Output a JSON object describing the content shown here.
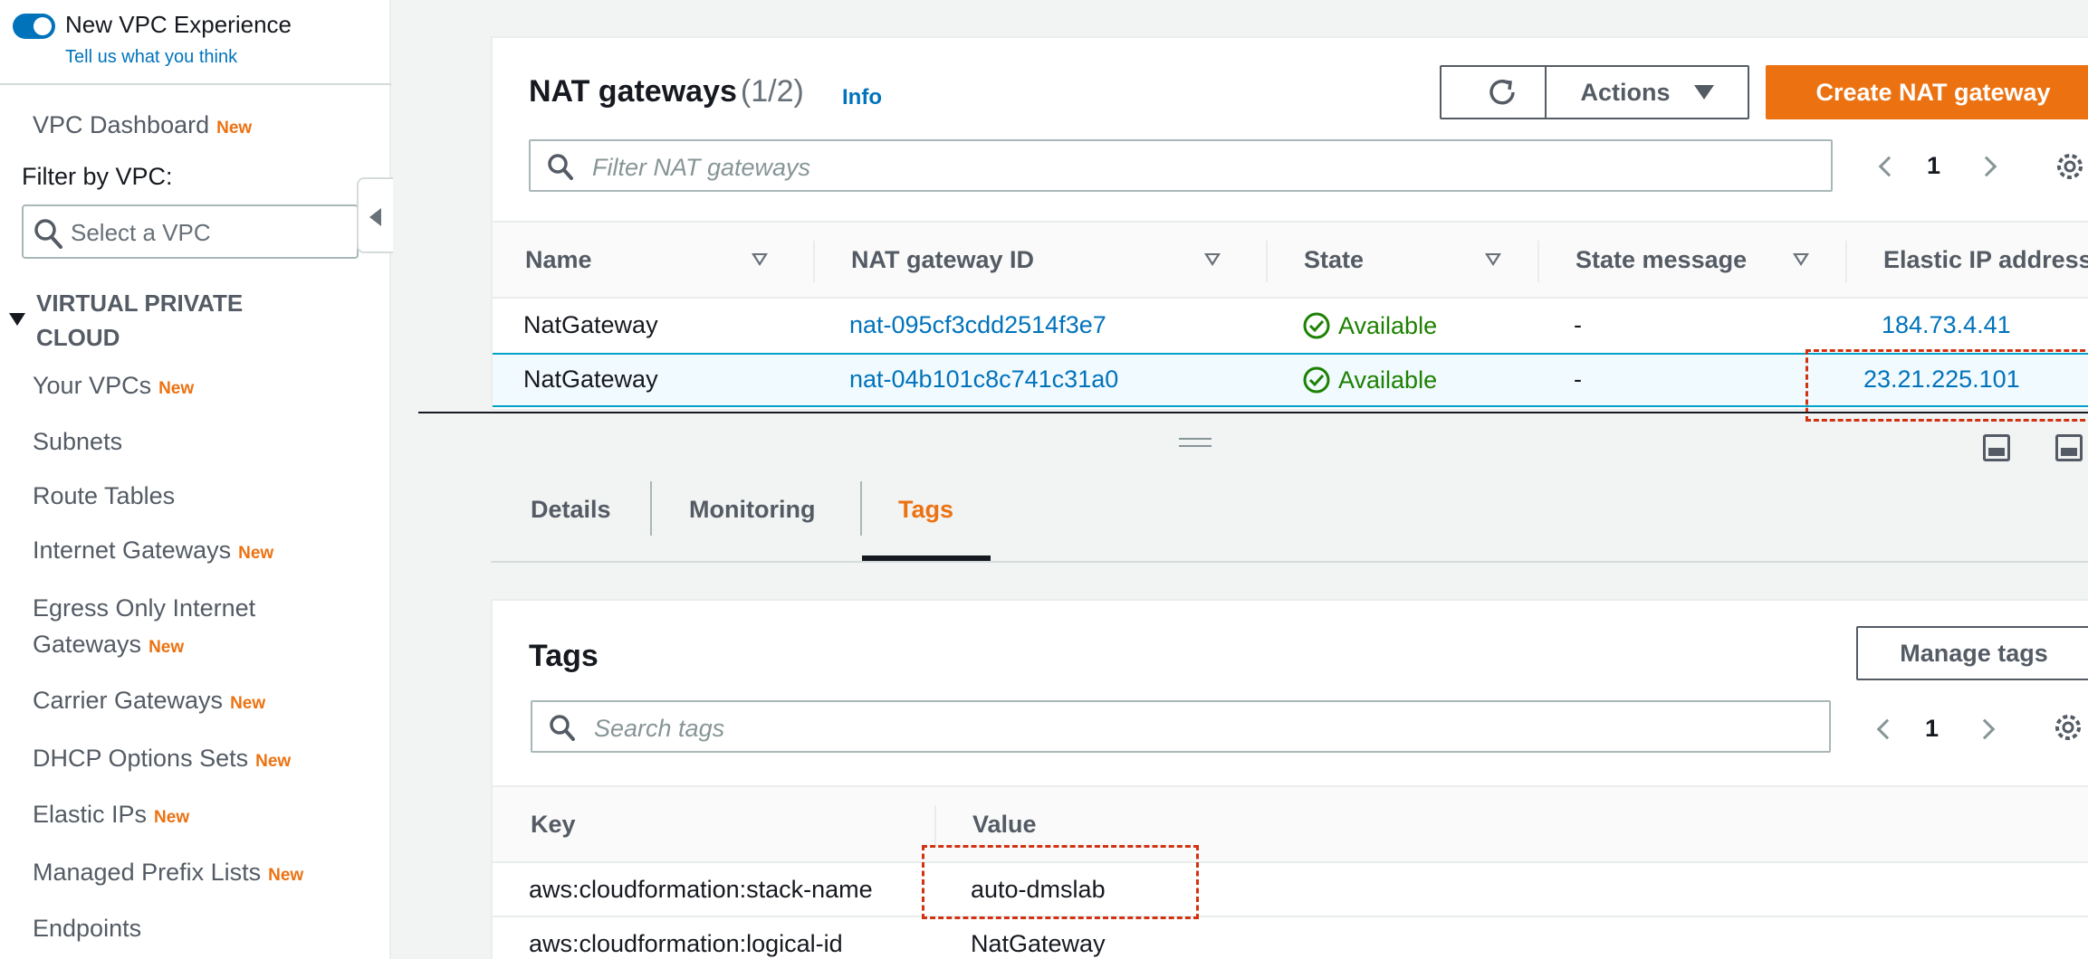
{
  "sidebar": {
    "experience_toggle_label": "New VPC Experience",
    "feedback_link": "Tell us what you think",
    "dashboard": {
      "label": "VPC Dashboard",
      "badge": "New"
    },
    "filter_label": "Filter by VPC:",
    "vpc_select_placeholder": "Select a VPC",
    "section_title": "VIRTUAL PRIVATE CLOUD",
    "items": [
      {
        "label": "Your VPCs",
        "badge": "New"
      },
      {
        "label": "Subnets",
        "badge": ""
      },
      {
        "label": "Route Tables",
        "badge": ""
      },
      {
        "label": "Internet Gateways",
        "badge": "New"
      },
      {
        "label": "Egress Only Internet Gateways",
        "line1": "Egress Only Internet",
        "line2": "Gateways",
        "badge": "New"
      },
      {
        "label": "Carrier Gateways",
        "badge": "New"
      },
      {
        "label": "DHCP Options Sets",
        "badge": "New"
      },
      {
        "label": "Elastic IPs",
        "badge": "New"
      },
      {
        "label": "Managed Prefix Lists",
        "badge": "New"
      },
      {
        "label": "Endpoints",
        "badge": ""
      }
    ]
  },
  "nat_panel": {
    "title": "NAT gateways",
    "count": "(1/2)",
    "info_link": "Info",
    "actions_label": "Actions",
    "create_label": "Create NAT gateway",
    "search_placeholder": "Filter NAT gateways",
    "page": "1",
    "columns": [
      "Name",
      "NAT gateway ID",
      "State",
      "State message",
      "Elastic IP address"
    ],
    "rows": [
      {
        "name": "NatGateway",
        "id": "nat-095cf3cdd2514f3e7",
        "state": "Available",
        "message": "-",
        "eip": "184.73.4.41",
        "selected": false
      },
      {
        "name": "NatGateway",
        "id": "nat-04b101c8c741c31a0",
        "state": "Available",
        "message": "-",
        "eip": "23.21.225.101",
        "selected": true
      }
    ]
  },
  "detail_tabs": [
    {
      "label": "Details",
      "active": false
    },
    {
      "label": "Monitoring",
      "active": false
    },
    {
      "label": "Tags",
      "active": true
    }
  ],
  "tags_panel": {
    "title": "Tags",
    "manage_label": "Manage tags",
    "search_placeholder": "Search tags",
    "page": "1",
    "columns": [
      "Key",
      "Value"
    ],
    "rows": [
      {
        "key": "aws:cloudformation:stack-name",
        "value": "auto-dmslab"
      },
      {
        "key": "aws:cloudformation:logical-id",
        "value": "NatGateway"
      }
    ]
  },
  "colors": {
    "accent_orange": "#ec7211",
    "link_blue": "#0073bb",
    "success_green": "#1d8102",
    "highlight_red": "#d13212"
  }
}
